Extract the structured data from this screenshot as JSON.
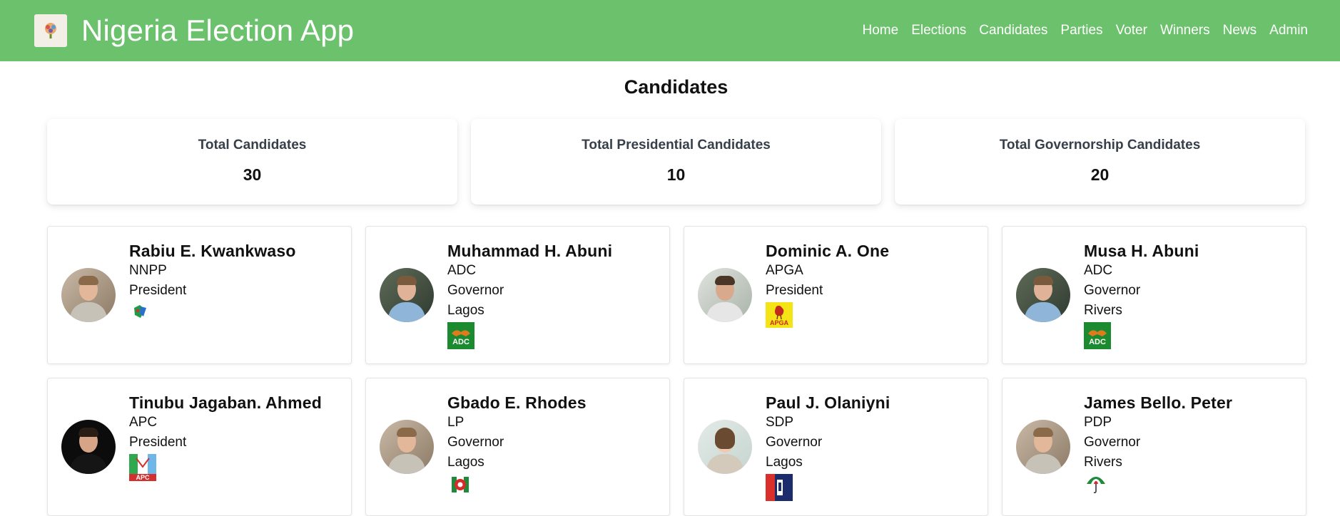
{
  "header": {
    "title": "Nigeria Election App",
    "logo_icon": "election-logo-icon",
    "nav": [
      {
        "label": "Home"
      },
      {
        "label": "Elections"
      },
      {
        "label": "Candidates"
      },
      {
        "label": "Parties"
      },
      {
        "label": "Voter"
      },
      {
        "label": "Winners"
      },
      {
        "label": "News"
      },
      {
        "label": "Admin"
      }
    ],
    "color": "#6cc16c"
  },
  "page": {
    "title": "Candidates"
  },
  "stats": [
    {
      "label": "Total Candidates",
      "value": "30"
    },
    {
      "label": "Total Presidential Candidates",
      "value": "10"
    },
    {
      "label": "Total Governorship Candidates",
      "value": "20"
    }
  ],
  "candidates": [
    {
      "name": "Rabiu E. Kwankwaso",
      "party": "NNPP",
      "office": "President",
      "state": "",
      "logo_icon": "nnpp-logo-icon"
    },
    {
      "name": "Muhammad H. Abuni",
      "party": "ADC",
      "office": "Governor",
      "state": "Lagos",
      "logo_icon": "adc-logo-icon"
    },
    {
      "name": "Dominic A. One",
      "party": "APGA",
      "office": "President",
      "state": "",
      "logo_icon": "apga-logo-icon"
    },
    {
      "name": "Musa H. Abuni",
      "party": "ADC",
      "office": "Governor",
      "state": "Rivers",
      "logo_icon": "adc-logo-icon"
    },
    {
      "name": "Tinubu Jagaban. Ahmed",
      "party": "APC",
      "office": "President",
      "state": "",
      "logo_icon": "apc-logo-icon"
    },
    {
      "name": "Gbado E. Rhodes",
      "party": "LP",
      "office": "Governor",
      "state": "Lagos",
      "logo_icon": "lp-logo-icon"
    },
    {
      "name": "Paul J. Olaniyni",
      "party": "SDP",
      "office": "Governor",
      "state": "Lagos",
      "logo_icon": "sdp-logo-icon"
    },
    {
      "name": "James Bello. Peter",
      "party": "PDP",
      "office": "Governor",
      "state": "Rivers",
      "logo_icon": "pdp-logo-icon"
    }
  ],
  "logo_labels": {
    "adc": "ADC",
    "apga": "APGA",
    "apc": "APC"
  }
}
